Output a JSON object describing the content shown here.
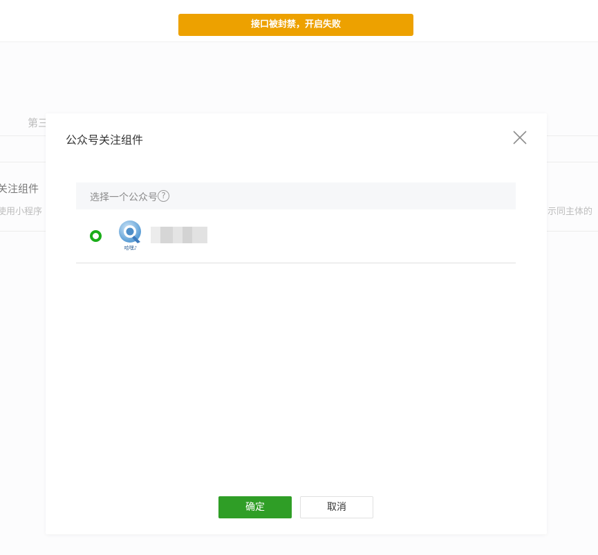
{
  "toast": {
    "message": "接口被封禁，开启失败",
    "color": "#eda100"
  },
  "background": {
    "tab_fragment": "第三",
    "section_title_fragment": "关注组件",
    "desc_left_fragment": "使用小程序",
    "desc_right_fragment": "示同主体的"
  },
  "dialog": {
    "title": "公众号关注组件",
    "close_icon": "close-icon",
    "list_header": "选择一个公众号",
    "help_icon_glyph": "?",
    "accounts": [
      {
        "selected": true,
        "avatar_icon": "q-logo-icon",
        "avatar_caption": "哈嘿♪"
      }
    ],
    "confirm_label": "确定",
    "cancel_label": "取消",
    "accent_color": "#1aad19",
    "confirm_color": "#2f9e26"
  }
}
